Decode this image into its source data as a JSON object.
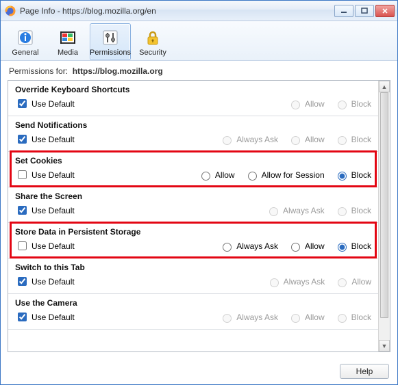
{
  "window": {
    "title": "Page Info - https://blog.mozilla.org/en"
  },
  "toolbar": {
    "items": [
      {
        "label": "General",
        "icon": "info-icon"
      },
      {
        "label": "Media",
        "icon": "media-icon"
      },
      {
        "label": "Permissions",
        "icon": "sliders-icon"
      },
      {
        "label": "Security",
        "icon": "lock-icon"
      }
    ],
    "selectedIndex": 2
  },
  "permissionsFor": {
    "prefix": "Permissions for:",
    "url": "https://blog.mozilla.org"
  },
  "useDefaultLabel": "Use Default",
  "options": {
    "allow": "Allow",
    "block": "Block",
    "alwaysAsk": "Always Ask",
    "allowForSession": "Allow for Session"
  },
  "permissions": [
    {
      "title": "Override Keyboard Shortcuts",
      "useDefault": true,
      "disabled": true,
      "options": [
        "allow",
        "block"
      ],
      "selected": null,
      "highlight": false
    },
    {
      "title": "Send Notifications",
      "useDefault": true,
      "disabled": true,
      "options": [
        "alwaysAsk",
        "allow",
        "block"
      ],
      "selected": null,
      "highlight": false
    },
    {
      "title": "Set Cookies",
      "useDefault": false,
      "disabled": false,
      "options": [
        "allow",
        "allowForSession",
        "block"
      ],
      "selected": "block",
      "highlight": true
    },
    {
      "title": "Share the Screen",
      "useDefault": true,
      "disabled": true,
      "options": [
        "alwaysAsk",
        "block"
      ],
      "selected": null,
      "highlight": false
    },
    {
      "title": "Store Data in Persistent Storage",
      "useDefault": false,
      "disabled": false,
      "options": [
        "alwaysAsk",
        "allow",
        "block"
      ],
      "selected": "block",
      "highlight": true
    },
    {
      "title": "Switch to this Tab",
      "useDefault": true,
      "disabled": true,
      "options": [
        "alwaysAsk",
        "allow"
      ],
      "selected": null,
      "highlight": false
    },
    {
      "title": "Use the Camera",
      "useDefault": true,
      "disabled": true,
      "options": [
        "alwaysAsk",
        "allow",
        "block"
      ],
      "selected": null,
      "highlight": false
    }
  ],
  "footer": {
    "help": "Help"
  }
}
